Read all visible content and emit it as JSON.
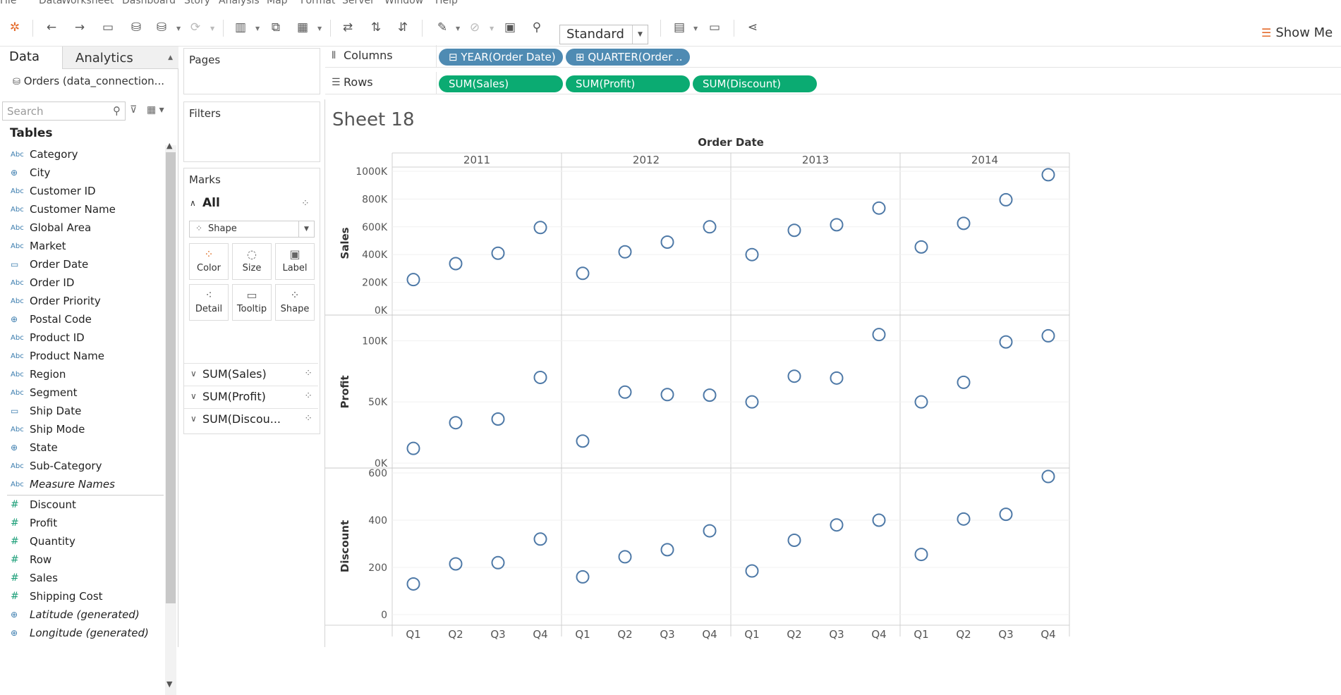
{
  "menu": [
    "File",
    "Data",
    "Worksheet",
    "Dashboard",
    "Story",
    "Analysis",
    "Map",
    "Format",
    "Server",
    "Window",
    "Help"
  ],
  "toolbar": {
    "view_size": "Standard",
    "show_me": "Show Me",
    "icons": [
      "tableau-logo-icon",
      "undo-icon",
      "redo-icon",
      "save-icon",
      "new-datasource-icon",
      "pause-update-icon",
      "refresh-icon",
      "new-worksheet-icon",
      "duplicate-sheet-icon",
      "clear-sheet-icon",
      "swap-icon",
      "sort-ascending-icon",
      "sort-descending-icon",
      "highlight-icon",
      "group-icon",
      "label-icon",
      "pin-icon",
      "fit-icon",
      "presentation-icon",
      "share-icon"
    ]
  },
  "data_pane": {
    "tab_data": "Data",
    "tab_analytics": "Analytics",
    "connection": "Orders (data_connection...",
    "search_placeholder": "Search",
    "tables_heading": "Tables",
    "dimensions": [
      {
        "type": "Abc",
        "name": "Category"
      },
      {
        "type": "geo",
        "name": "City"
      },
      {
        "type": "Abc",
        "name": "Customer ID"
      },
      {
        "type": "Abc",
        "name": "Customer Name"
      },
      {
        "type": "Abc",
        "name": "Global Area"
      },
      {
        "type": "Abc",
        "name": "Market"
      },
      {
        "type": "date",
        "name": "Order Date"
      },
      {
        "type": "Abc",
        "name": "Order ID"
      },
      {
        "type": "Abc",
        "name": "Order Priority"
      },
      {
        "type": "geo",
        "name": "Postal Code"
      },
      {
        "type": "Abc",
        "name": "Product ID"
      },
      {
        "type": "Abc",
        "name": "Product Name"
      },
      {
        "type": "Abc",
        "name": "Region"
      },
      {
        "type": "Abc",
        "name": "Segment"
      },
      {
        "type": "date",
        "name": "Ship Date"
      },
      {
        "type": "Abc",
        "name": "Ship Mode"
      },
      {
        "type": "geo",
        "name": "State"
      },
      {
        "type": "Abc",
        "name": "Sub-Category"
      },
      {
        "type": "Abc",
        "name": "Measure Names",
        "italic": true
      }
    ],
    "measures": [
      {
        "type": "#",
        "name": "Discount"
      },
      {
        "type": "#",
        "name": "Profit"
      },
      {
        "type": "#",
        "name": "Quantity"
      },
      {
        "type": "#",
        "name": "Row"
      },
      {
        "type": "#",
        "name": "Sales"
      },
      {
        "type": "#",
        "name": "Shipping Cost"
      },
      {
        "type": "geo",
        "name": "Latitude (generated)",
        "italic": true
      },
      {
        "type": "geo",
        "name": "Longitude (generated)",
        "italic": true
      }
    ]
  },
  "cards": {
    "pages": "Pages",
    "filters": "Filters",
    "marks": "Marks",
    "marks_all": "All",
    "mark_type": "Shape",
    "buttons": [
      "Color",
      "Size",
      "Label",
      "Detail",
      "Tooltip",
      "Shape"
    ],
    "measure_rows": [
      "SUM(Sales)",
      "SUM(Profit)",
      "SUM(Discou..."
    ]
  },
  "shelves": {
    "columns_label": "Columns",
    "rows_label": "Rows",
    "columns_pills": [
      "YEAR(Order Date)",
      "QUARTER(Order .."
    ],
    "rows_pills": [
      "SUM(Sales)",
      "SUM(Profit)",
      "SUM(Discount)"
    ]
  },
  "sheet_title": "Sheet 18",
  "chart_data": {
    "type": "scatter",
    "title": "Order Date",
    "years": [
      "2011",
      "2012",
      "2013",
      "2014"
    ],
    "quarters": [
      "Q1",
      "Q2",
      "Q3",
      "Q4"
    ],
    "mark_color": "#4e79a7",
    "series": [
      {
        "name": "Sales",
        "ylim": [
          0,
          1000000
        ],
        "ticks": [
          {
            "v": 0,
            "l": "0K"
          },
          {
            "v": 200000,
            "l": "200K"
          },
          {
            "v": 400000,
            "l": "400K"
          },
          {
            "v": 600000,
            "l": "600K"
          },
          {
            "v": 800000,
            "l": "800K"
          },
          {
            "v": 1000000,
            "l": "1000K"
          }
        ],
        "values": [
          [
            220000,
            335000,
            410000,
            595000
          ],
          [
            265000,
            420000,
            490000,
            600000
          ],
          [
            400000,
            575000,
            615000,
            735000
          ],
          [
            455000,
            625000,
            795000,
            975000
          ]
        ]
      },
      {
        "name": "Profit",
        "ylim": [
          0,
          110000
        ],
        "ticks": [
          {
            "v": 0,
            "l": "0K"
          },
          {
            "v": 50000,
            "l": "50K"
          },
          {
            "v": 100000,
            "l": "100K"
          }
        ],
        "values": [
          [
            12000,
            33000,
            36000,
            70000
          ],
          [
            18000,
            58000,
            56000,
            55500
          ],
          [
            50000,
            71000,
            69500,
            105000
          ],
          [
            50000,
            66000,
            99000,
            104000
          ]
        ]
      },
      {
        "name": "Discount",
        "ylim": [
          0,
          600
        ],
        "ticks": [
          {
            "v": 0,
            "l": "0"
          },
          {
            "v": 200,
            "l": "200"
          },
          {
            "v": 400,
            "l": "400"
          },
          {
            "v": 600,
            "l": "600"
          }
        ],
        "values": [
          [
            130,
            215,
            220,
            320
          ],
          [
            160,
            245,
            275,
            355
          ],
          [
            185,
            315,
            380,
            400
          ],
          [
            255,
            405,
            425,
            585
          ]
        ]
      }
    ]
  }
}
